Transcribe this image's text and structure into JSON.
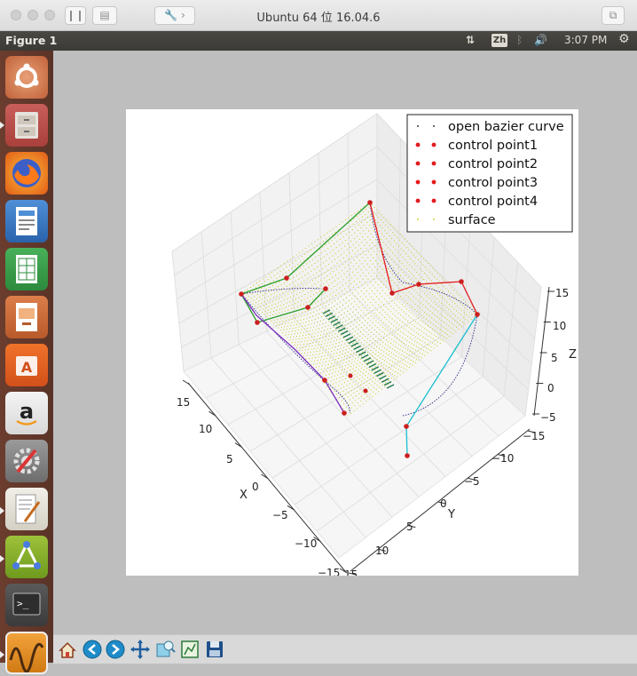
{
  "window": {
    "title": "Ubuntu 64 位 16.04.6"
  },
  "panel": {
    "app_name": "Figure 1",
    "input_method": "Zh",
    "time": "3:07 PM"
  },
  "launcher": {
    "items": [
      "ubuntu-dash",
      "file-cabinet",
      "firefox",
      "writer",
      "calc",
      "impress",
      "software-center",
      "amazon",
      "system-settings",
      "text-editor",
      "kstars",
      "terminal",
      "system-monitor"
    ]
  },
  "legend": {
    "items": [
      {
        "label": "open bazier curve",
        "marker": "dot-black"
      },
      {
        "label": "control point1",
        "marker": "dot-red"
      },
      {
        "label": "control point2",
        "marker": "dot-red"
      },
      {
        "label": "control point3",
        "marker": "dot-red"
      },
      {
        "label": "control point4",
        "marker": "dot-red"
      },
      {
        "label": "surface",
        "marker": "dot-yellow"
      }
    ]
  },
  "axes": {
    "x": {
      "label": "X",
      "ticks": [
        "15",
        "10",
        "5",
        "0",
        "−5",
        "−10",
        "−15"
      ]
    },
    "y": {
      "label": "Y",
      "ticks": [
        "−15",
        "−10",
        "−5",
        "0",
        "5",
        "10",
        "15"
      ]
    },
    "z": {
      "label": "Z",
      "ticks": [
        "15",
        "10",
        "5",
        "0",
        "−5"
      ]
    }
  },
  "chart_data": {
    "type": "scatter",
    "projection": "3d",
    "series": [
      {
        "name": "open bazier curve",
        "color": "#000000"
      },
      {
        "name": "control point1",
        "color": "#e41a1c"
      },
      {
        "name": "control point2",
        "color": "#e41a1c"
      },
      {
        "name": "control point3",
        "color": "#e41a1c"
      },
      {
        "name": "control point4",
        "color": "#e41a1c"
      },
      {
        "name": "surface",
        "color": "#c8c800"
      }
    ],
    "xlim": [
      -15,
      15
    ],
    "ylim": [
      -15,
      15
    ],
    "zlim": [
      -5,
      15
    ],
    "legend_position": "top-right",
    "grid": true
  },
  "colors": {
    "polyline1": "#2ca02c",
    "polyline2": "#e41a1c",
    "polyline3": "#7b2fbe",
    "polyline4": "#17becf"
  },
  "toolbar": {
    "tools": [
      "home-icon",
      "back-arrow-icon",
      "forward-arrow-icon",
      "pan-icon",
      "zoom-icon",
      "subplots-icon",
      "save-icon"
    ]
  }
}
